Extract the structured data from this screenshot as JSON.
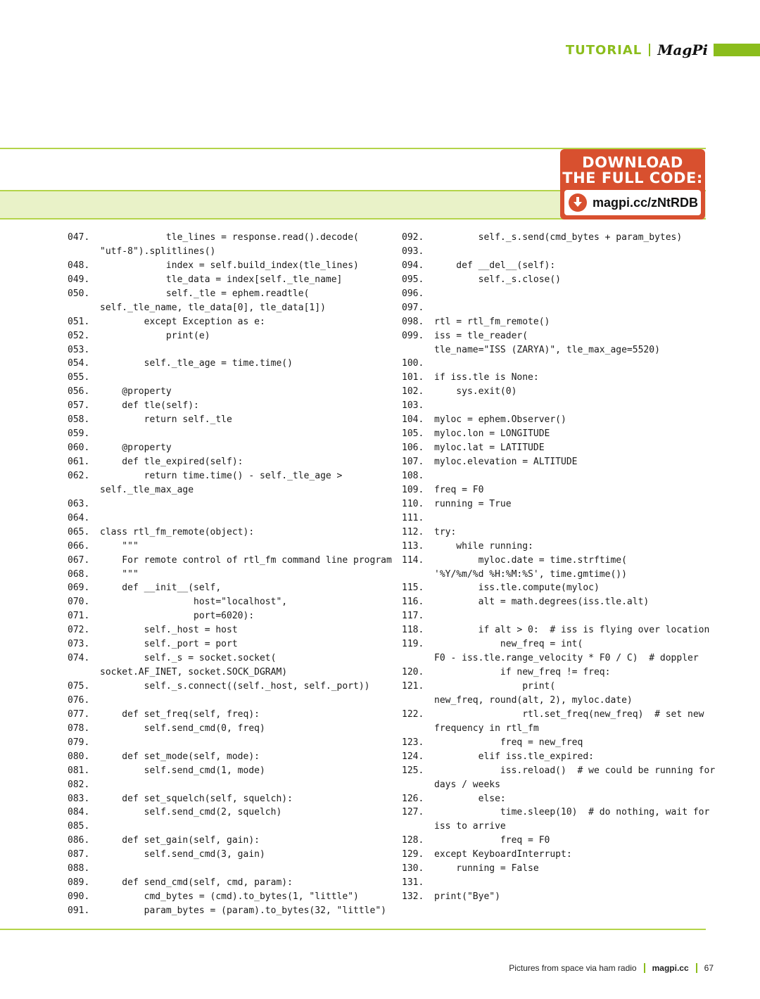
{
  "header": {
    "section": "TUTORIAL",
    "logo": "MagPi"
  },
  "download": {
    "title_line1": "DOWNLOAD",
    "title_line2": "THE FULL CODE:",
    "url": "magpi.cc/zNtRDB"
  },
  "code_left": [
    {
      "n": "047.",
      "t": "            tle_lines = response.read().decode("
    },
    {
      "n": "",
      "t": "\"utf-8\").splitlines()"
    },
    {
      "n": "048.",
      "t": "            index = self.build_index(tle_lines)"
    },
    {
      "n": "049.",
      "t": "            tle_data = index[self._tle_name]"
    },
    {
      "n": "050.",
      "t": "            self._tle = ephem.readtle("
    },
    {
      "n": "",
      "t": "self._tle_name, tle_data[0], tle_data[1])"
    },
    {
      "n": "051.",
      "t": "        except Exception as e:"
    },
    {
      "n": "052.",
      "t": "            print(e)"
    },
    {
      "n": "053.",
      "t": ""
    },
    {
      "n": "054.",
      "t": "        self._tle_age = time.time()"
    },
    {
      "n": "055.",
      "t": ""
    },
    {
      "n": "056.",
      "t": "    @property"
    },
    {
      "n": "057.",
      "t": "    def tle(self):"
    },
    {
      "n": "058.",
      "t": "        return self._tle"
    },
    {
      "n": "059.",
      "t": ""
    },
    {
      "n": "060.",
      "t": "    @property"
    },
    {
      "n": "061.",
      "t": "    def tle_expired(self):"
    },
    {
      "n": "062.",
      "t": "        return time.time() - self._tle_age >"
    },
    {
      "n": "",
      "t": "self._tle_max_age"
    },
    {
      "n": "063.",
      "t": ""
    },
    {
      "n": "064.",
      "t": ""
    },
    {
      "n": "065.",
      "t": "class rtl_fm_remote(object):"
    },
    {
      "n": "066.",
      "t": "    \"\"\""
    },
    {
      "n": "067.",
      "t": "    For remote control of rtl_fm command line program"
    },
    {
      "n": "068.",
      "t": "    \"\"\""
    },
    {
      "n": "069.",
      "t": "    def __init__(self,"
    },
    {
      "n": "070.",
      "t": "                 host=\"localhost\","
    },
    {
      "n": "071.",
      "t": "                 port=6020):"
    },
    {
      "n": "072.",
      "t": "        self._host = host"
    },
    {
      "n": "073.",
      "t": "        self._port = port"
    },
    {
      "n": "074.",
      "t": "        self._s = socket.socket("
    },
    {
      "n": "",
      "t": "socket.AF_INET, socket.SOCK_DGRAM)"
    },
    {
      "n": "075.",
      "t": "        self._s.connect((self._host, self._port))"
    },
    {
      "n": "076.",
      "t": ""
    },
    {
      "n": "077.",
      "t": "    def set_freq(self, freq):"
    },
    {
      "n": "078.",
      "t": "        self.send_cmd(0, freq)"
    },
    {
      "n": "079.",
      "t": ""
    },
    {
      "n": "080.",
      "t": "    def set_mode(self, mode):"
    },
    {
      "n": "081.",
      "t": "        self.send_cmd(1, mode)"
    },
    {
      "n": "082.",
      "t": ""
    },
    {
      "n": "083.",
      "t": "    def set_squelch(self, squelch):"
    },
    {
      "n": "084.",
      "t": "        self.send_cmd(2, squelch)"
    },
    {
      "n": "085.",
      "t": ""
    },
    {
      "n": "086.",
      "t": "    def set_gain(self, gain):"
    },
    {
      "n": "087.",
      "t": "        self.send_cmd(3, gain)"
    },
    {
      "n": "088.",
      "t": ""
    },
    {
      "n": "089.",
      "t": "    def send_cmd(self, cmd, param):"
    },
    {
      "n": "090.",
      "t": "        cmd_bytes = (cmd).to_bytes(1, \"little\")"
    },
    {
      "n": "091.",
      "t": "        param_bytes = (param).to_bytes(32, \"little\")"
    }
  ],
  "code_right": [
    {
      "n": "092.",
      "t": "        self._s.send(cmd_bytes + param_bytes)"
    },
    {
      "n": "093.",
      "t": ""
    },
    {
      "n": "094.",
      "t": "    def __del__(self):"
    },
    {
      "n": "095.",
      "t": "        self._s.close()"
    },
    {
      "n": "096.",
      "t": ""
    },
    {
      "n": "097.",
      "t": ""
    },
    {
      "n": "098.",
      "t": "rtl = rtl_fm_remote()"
    },
    {
      "n": "099.",
      "t": "iss = tle_reader("
    },
    {
      "n": "",
      "t": "tle_name=\"ISS (ZARYA)\", tle_max_age=5520)"
    },
    {
      "n": "100.",
      "t": ""
    },
    {
      "n": "101.",
      "t": "if iss.tle is None:"
    },
    {
      "n": "102.",
      "t": "    sys.exit(0)"
    },
    {
      "n": "103.",
      "t": ""
    },
    {
      "n": "104.",
      "t": "myloc = ephem.Observer()"
    },
    {
      "n": "105.",
      "t": "myloc.lon = LONGITUDE"
    },
    {
      "n": "106.",
      "t": "myloc.lat = LATITUDE"
    },
    {
      "n": "107.",
      "t": "myloc.elevation = ALTITUDE"
    },
    {
      "n": "108.",
      "t": ""
    },
    {
      "n": "109.",
      "t": "freq = F0"
    },
    {
      "n": "110.",
      "t": "running = True"
    },
    {
      "n": "111.",
      "t": ""
    },
    {
      "n": "112.",
      "t": "try:"
    },
    {
      "n": "113.",
      "t": "    while running:"
    },
    {
      "n": "114.",
      "t": "        myloc.date = time.strftime("
    },
    {
      "n": "",
      "t": "'%Y/%m/%d %H:%M:%S', time.gmtime())"
    },
    {
      "n": "115.",
      "t": "        iss.tle.compute(myloc)"
    },
    {
      "n": "116.",
      "t": "        alt = math.degrees(iss.tle.alt)"
    },
    {
      "n": "117.",
      "t": ""
    },
    {
      "n": "118.",
      "t": "        if alt > 0:  # iss is flying over location"
    },
    {
      "n": "119.",
      "t": "            new_freq = int("
    },
    {
      "n": "",
      "t": "F0 - iss.tle.range_velocity * F0 / C)  # doppler"
    },
    {
      "n": "120.",
      "t": "            if new_freq != freq:"
    },
    {
      "n": "121.",
      "t": "                print("
    },
    {
      "n": "",
      "t": "new_freq, round(alt, 2), myloc.date)"
    },
    {
      "n": "122.",
      "t": "                rtl.set_freq(new_freq)  # set new"
    },
    {
      "n": "",
      "t": "frequency in rtl_fm"
    },
    {
      "n": "123.",
      "t": "            freq = new_freq"
    },
    {
      "n": "124.",
      "t": "        elif iss.tle_expired:"
    },
    {
      "n": "125.",
      "t": "            iss.reload()  # we could be running for"
    },
    {
      "n": "",
      "t": "days / weeks"
    },
    {
      "n": "126.",
      "t": "        else:"
    },
    {
      "n": "127.",
      "t": "            time.sleep(10)  # do nothing, wait for"
    },
    {
      "n": "",
      "t": "iss to arrive"
    },
    {
      "n": "128.",
      "t": "            freq = F0"
    },
    {
      "n": "129.",
      "t": "except KeyboardInterrupt:"
    },
    {
      "n": "130.",
      "t": "    running = False"
    },
    {
      "n": "131.",
      "t": ""
    },
    {
      "n": "132.",
      "t": "print(\"Bye\")"
    }
  ],
  "footer": {
    "article": "Pictures from space via ham radio",
    "site": "magpi.cc",
    "page": "67"
  },
  "colors": {
    "accent_green": "#8bbd1c",
    "download_red": "#d8502f",
    "band_fill": "#e9f2c8"
  }
}
